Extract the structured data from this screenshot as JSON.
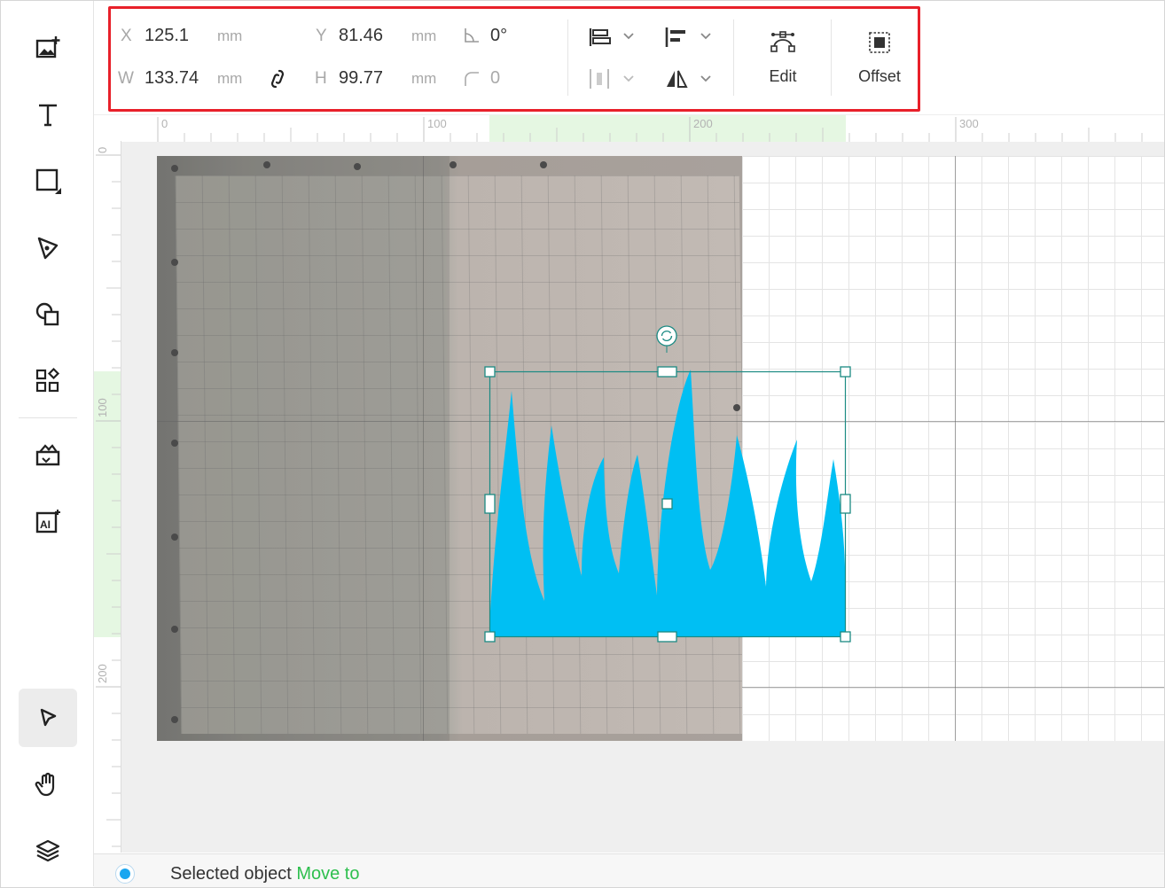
{
  "props": {
    "x_label": "X",
    "x_value": "125.1",
    "x_unit": "mm",
    "y_label": "Y",
    "y_value": "81.46",
    "y_unit": "mm",
    "w_label": "W",
    "w_value": "133.74",
    "w_unit": "mm",
    "h_label": "H",
    "h_value": "99.77",
    "h_unit": "mm",
    "angle_value": "0°",
    "corner_value": "0",
    "edit_label": "Edit",
    "offset_label": "Offset"
  },
  "ruler": {
    "top_labels": [
      "0",
      "100",
      "200",
      "300"
    ],
    "left_labels": [
      "0",
      "100",
      "200"
    ]
  },
  "status": {
    "text": "Selected object",
    "link": "Move to"
  },
  "tools": [
    "add-image-icon",
    "text-icon",
    "rectangle-icon",
    "pen-icon",
    "shapes-icon",
    "elements-icon",
    "material-library-icon",
    "ai-image-icon",
    "select-icon",
    "hand-icon",
    "layers-icon"
  ],
  "colors": {
    "accent": "#2ebf4e",
    "shape": "#00bff3",
    "highlight": "#e8202a",
    "selection": "#1b8a83"
  }
}
